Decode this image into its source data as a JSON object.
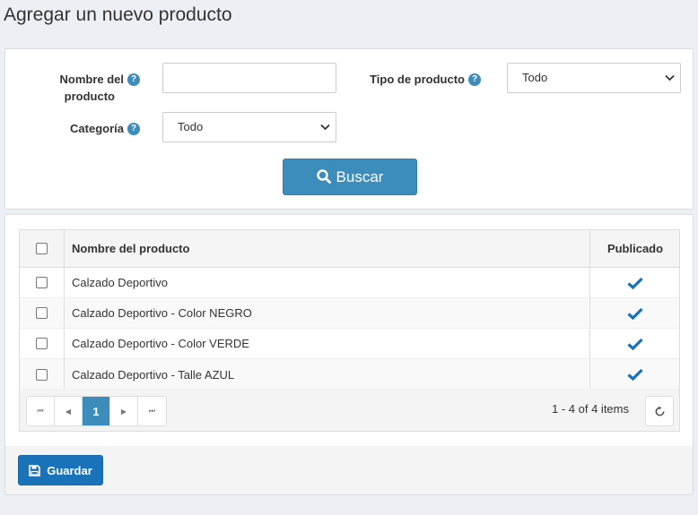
{
  "page": {
    "title": "Agregar un nuevo producto"
  },
  "search": {
    "name_label_line1": "Nombre del",
    "name_label_line2": "producto",
    "name_value": "",
    "type_label": "Tipo de producto",
    "type_value": "Todo",
    "category_label": "Categoría",
    "category_value": "Todo",
    "search_button": "Buscar",
    "help_glyph": "?"
  },
  "grid": {
    "columns": {
      "name": "Nombre del producto",
      "published": "Publicado"
    },
    "rows": [
      {
        "name": "Calzado Deportivo",
        "published": true
      },
      {
        "name": "Calzado Deportivo - Color NEGRO",
        "published": true
      },
      {
        "name": "Calzado Deportivo - Color VERDE",
        "published": true
      },
      {
        "name": "Calzado Deportivo - Talle AZUL",
        "published": true
      }
    ],
    "pager": {
      "first": "⏮",
      "prev": "◀",
      "current": "1",
      "next": "▶",
      "last": "⏭",
      "info": "1 - 4 of 4 items"
    }
  },
  "footer": {
    "save_button": "Guardar"
  },
  "colors": {
    "primary": "#3c8dbc",
    "save": "#1a73b8",
    "check": "#1a73b8"
  }
}
